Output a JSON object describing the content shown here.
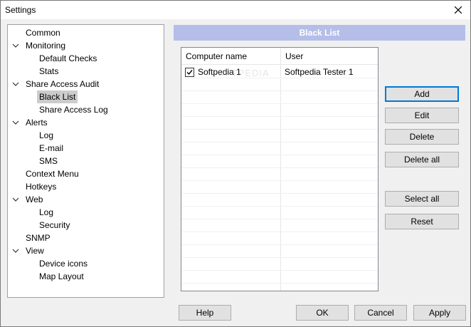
{
  "window": {
    "title": "Settings"
  },
  "tree": [
    {
      "label": "Common",
      "chevron": false
    },
    {
      "label": "Monitoring",
      "chevron": true
    },
    {
      "label": "Default Checks",
      "chevron": false
    },
    {
      "label": "Stats",
      "chevron": false
    },
    {
      "label": "Share Access Audit",
      "chevron": true
    },
    {
      "label": "Black List",
      "chevron": false,
      "selected": true
    },
    {
      "label": "Share Access Log",
      "chevron": false
    },
    {
      "label": "Alerts",
      "chevron": true
    },
    {
      "label": "Log",
      "chevron": false
    },
    {
      "label": "E-mail",
      "chevron": false
    },
    {
      "label": "SMS",
      "chevron": false
    },
    {
      "label": "Context Menu",
      "chevron": false
    },
    {
      "label": "Hotkeys",
      "chevron": false
    },
    {
      "label": "Web",
      "chevron": true
    },
    {
      "label": "Log",
      "chevron": false
    },
    {
      "label": "Security",
      "chevron": false
    },
    {
      "label": "SNMP",
      "chevron": false
    },
    {
      "label": "View",
      "chevron": true
    },
    {
      "label": "Device icons",
      "chevron": false
    },
    {
      "label": "Map Layout",
      "chevron": false
    }
  ],
  "panel": {
    "title": "Black List",
    "columns": [
      "Computer name",
      "User"
    ],
    "rows": [
      {
        "checked": true,
        "computer": "Softpedia 1",
        "user": "Softpedia Tester 1"
      }
    ]
  },
  "side_buttons": {
    "add": "Add",
    "edit": "Edit",
    "delete": "Delete",
    "delete_all": "Delete all",
    "select_all": "Select all",
    "reset": "Reset"
  },
  "bottom_buttons": {
    "help": "Help",
    "ok": "OK",
    "cancel": "Cancel",
    "apply": "Apply"
  },
  "colors": {
    "header_bg": "#b5bee8",
    "selected_bg": "#cccccc",
    "default_button_border": "#0078d7"
  }
}
